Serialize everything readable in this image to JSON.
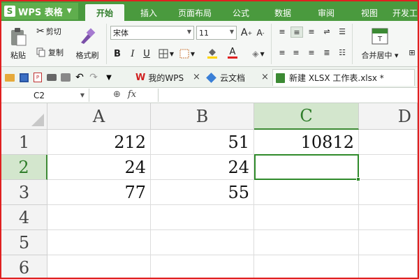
{
  "app": {
    "name": "WPS 表格",
    "logo": "S"
  },
  "ribbon_tabs": [
    "开始",
    "插入",
    "页面布局",
    "公式",
    "数据",
    "审阅",
    "视图",
    "开发工"
  ],
  "ribbon": {
    "paste": "粘贴",
    "cut": "剪切",
    "copy": "复制",
    "format_painter": "格式刷",
    "font_name": "宋体",
    "font_size": "11",
    "merge_center": "合并居中",
    "bold": "B",
    "italic": "I",
    "underline": "U",
    "font_color_glyph": "A",
    "grow_font": "A",
    "shrink_font": "A"
  },
  "doc_tabs": [
    {
      "label": "我的WPS"
    },
    {
      "label": "云文档"
    },
    {
      "label": "新建 XLSX 工作表.xlsx *"
    }
  ],
  "formula_bar": {
    "cell_ref": "C2",
    "fx": "fx",
    "value": ""
  },
  "sheet": {
    "columns": [
      "A",
      "B",
      "C",
      "D"
    ],
    "rows": [
      "1",
      "2",
      "3",
      "4",
      "5",
      "6"
    ],
    "cells": [
      [
        "212",
        "51",
        "10812",
        ""
      ],
      [
        "24",
        "24",
        "",
        ""
      ],
      [
        "77",
        "55",
        "",
        ""
      ],
      [
        "",
        "",
        "",
        ""
      ],
      [
        "",
        "",
        "",
        ""
      ],
      [
        "",
        "",
        "",
        ""
      ]
    ],
    "active_cell": "C2"
  },
  "colors": {
    "accent": "#4a9a3e",
    "selection": "#2f8a2a",
    "frame": "#e02020"
  }
}
